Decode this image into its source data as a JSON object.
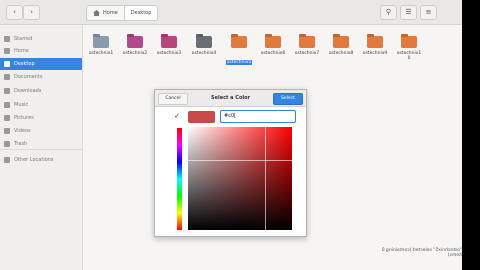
{
  "header": {
    "back_icon": "chevron-left-icon",
    "forward_icon": "chevron-right-icon",
    "path": [
      "Home",
      "Desktop"
    ],
    "search_icon": "search-icon",
    "view_icon": "list-view-icon",
    "menu_icon": "hamburger-menu-icon"
  },
  "sidebar": {
    "items": [
      {
        "label": "Starred",
        "icon": "star-icon"
      },
      {
        "label": "Home",
        "icon": "home-icon"
      },
      {
        "label": "Desktop",
        "icon": "desktop-icon",
        "active": true
      },
      {
        "label": "Documents",
        "icon": "document-icon"
      },
      {
        "label": "Downloads",
        "icon": "download-icon"
      },
      {
        "label": "Music",
        "icon": "music-icon"
      },
      {
        "label": "Pictures",
        "icon": "pictures-icon"
      },
      {
        "label": "Videos",
        "icon": "video-icon"
      },
      {
        "label": "Trash",
        "icon": "trash-icon"
      },
      {
        "label": "Other Locations",
        "icon": "plus-icon"
      }
    ]
  },
  "files": [
    {
      "name": "ostechnix1",
      "color": "#8a9bb0"
    },
    {
      "name": "ostechnix2",
      "color": "#b04a8a"
    },
    {
      "name": "ostechnix3",
      "color": "#b8457c"
    },
    {
      "name": "ostechnix4",
      "color": "#6b6f75"
    },
    {
      "name": "ostechnix5",
      "color": "#e07a3e",
      "selected": true
    },
    {
      "name": "ostechnix6",
      "color": "#e07a3e"
    },
    {
      "name": "ostechnix7",
      "color": "#e07a3e"
    },
    {
      "name": "ostechnix8",
      "color": "#e07a3e"
    },
    {
      "name": "ostechnix9",
      "color": "#e07a3e"
    },
    {
      "name": "ostechnix1\n0",
      "color": "#e07a3e"
    }
  ],
  "status_bar": "\"ostechnix5\" selected (containing 0 items)",
  "dialog": {
    "title": "Select a Color",
    "cancel_label": "Cancel",
    "select_label": "Select",
    "hex_value": "#c0[",
    "swatch_color": "#c84a4b",
    "eyedropper_icon": "eyedropper-icon"
  }
}
